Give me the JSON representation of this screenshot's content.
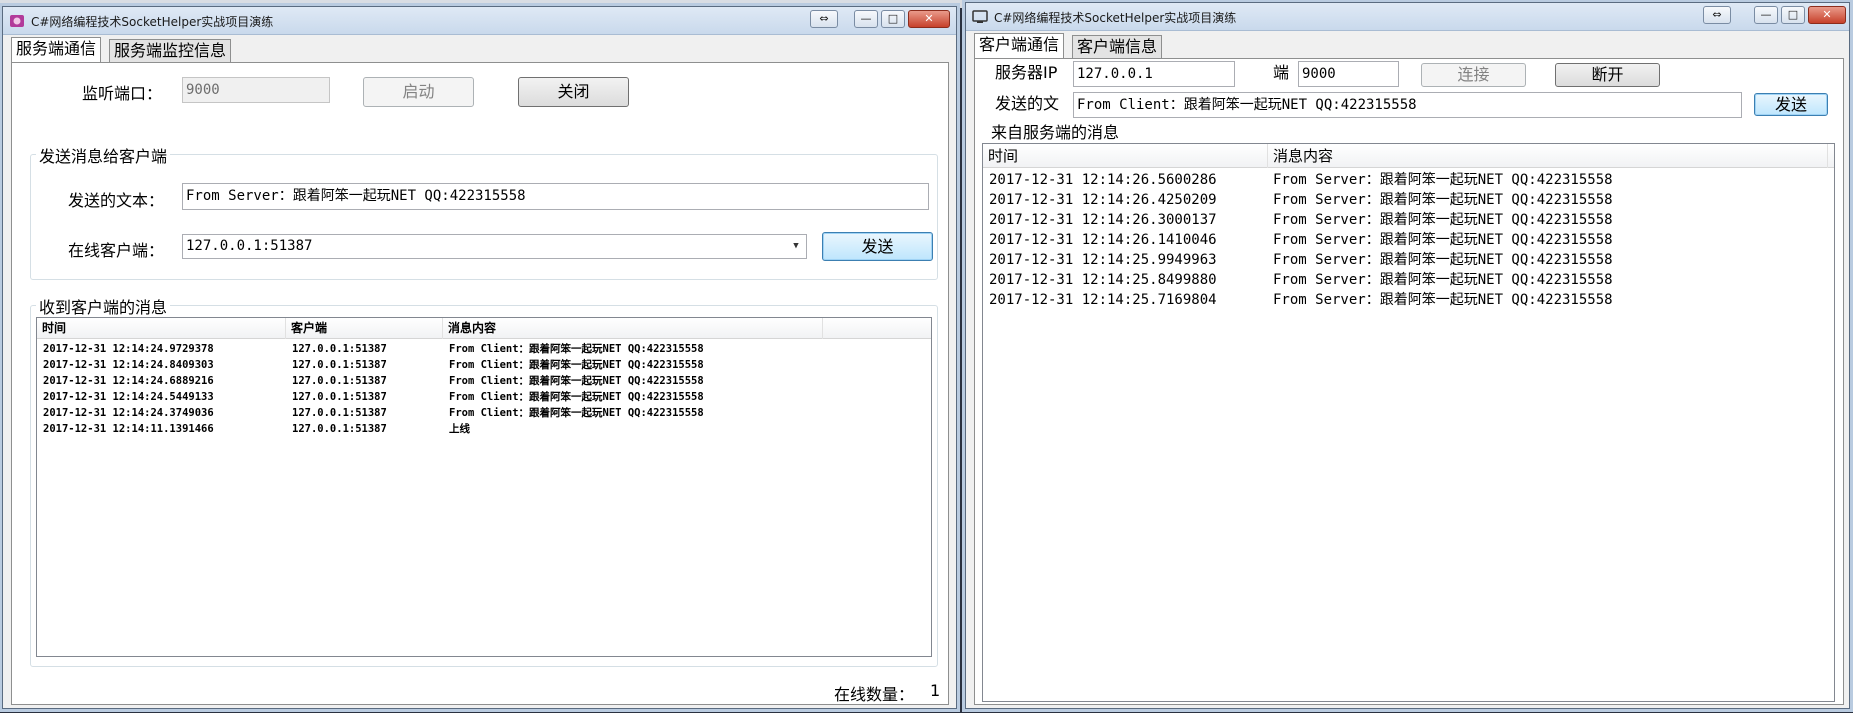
{
  "server_window": {
    "title": "C#网络编程技术SocketHelper实战项目演练",
    "buttons": {
      "restore": "⇔",
      "minimize": "—",
      "maximize": "□",
      "close": "✕"
    },
    "tabs": [
      {
        "label": "服务端通信",
        "active": true
      },
      {
        "label": "服务端监控信息",
        "active": false
      }
    ],
    "port_label": "监听端口：",
    "port_value": "9000",
    "start_button": "启动",
    "stop_button": "关闭",
    "send_group": {
      "title": "发送消息给客户端",
      "text_label": "发送的文本：",
      "text_value": "From Server：跟着阿笨一起玩NET QQ:422315558",
      "client_label": "在线客户端：",
      "client_value": "127.0.0.1:51387",
      "send_button": "发送"
    },
    "receive_group": {
      "title": "收到客户端的消息",
      "columns": [
        "时间",
        "客户端",
        "消息内容"
      ],
      "rows": [
        [
          "2017-12-31 12:14:24.9729378",
          "127.0.0.1:51387",
          "From Client：跟着阿笨一起玩NET QQ:422315558"
        ],
        [
          "2017-12-31 12:14:24.8409303",
          "127.0.0.1:51387",
          "From Client：跟着阿笨一起玩NET QQ:422315558"
        ],
        [
          "2017-12-31 12:14:24.6889216",
          "127.0.0.1:51387",
          "From Client：跟着阿笨一起玩NET QQ:422315558"
        ],
        [
          "2017-12-31 12:14:24.5449133",
          "127.0.0.1:51387",
          "From Client：跟着阿笨一起玩NET QQ:422315558"
        ],
        [
          "2017-12-31 12:14:24.3749036",
          "127.0.0.1:51387",
          "From Client：跟着阿笨一起玩NET QQ:422315558"
        ],
        [
          "2017-12-31 12:14:11.1391466",
          "127.0.0.1:51387",
          "上线"
        ]
      ]
    },
    "online_count_label": "在线数量：",
    "online_count_value": "1"
  },
  "client_window": {
    "title": "C#网络编程技术SocketHelper实战项目演练",
    "buttons": {
      "restore": "⇔",
      "minimize": "—",
      "maximize": "□",
      "close": "✕"
    },
    "tabs": [
      {
        "label": "客户端通信",
        "active": true
      },
      {
        "label": "客户端信息",
        "active": false
      }
    ],
    "server_ip_label": "服务器IP",
    "server_ip_value": "127.0.0.1",
    "port_label": "端",
    "port_value": "9000",
    "connect_button": "连接",
    "disconnect_button": "断开",
    "send_label": "发送的文",
    "send_value": "From Client：跟着阿笨一起玩NET QQ:422315558",
    "send_button": "发送",
    "messages_title": "来自服务端的消息",
    "columns": [
      "时间",
      "消息内容"
    ],
    "rows": [
      [
        "2017-12-31 12:14:26.5600286",
        "From Server：跟着阿笨一起玩NET QQ:422315558"
      ],
      [
        "2017-12-31 12:14:26.4250209",
        "From Server：跟着阿笨一起玩NET QQ:422315558"
      ],
      [
        "2017-12-31 12:14:26.3000137",
        "From Server：跟着阿笨一起玩NET QQ:422315558"
      ],
      [
        "2017-12-31 12:14:26.1410046",
        "From Server：跟着阿笨一起玩NET QQ:422315558"
      ],
      [
        "2017-12-31 12:14:25.9949963",
        "From Server：跟着阿笨一起玩NET QQ:422315558"
      ],
      [
        "2017-12-31 12:14:25.8499880",
        "From Server：跟着阿笨一起玩NET QQ:422315558"
      ],
      [
        "2017-12-31 12:14:25.7169804",
        "From Server：跟着阿笨一起玩NET QQ:422315558"
      ]
    ]
  }
}
